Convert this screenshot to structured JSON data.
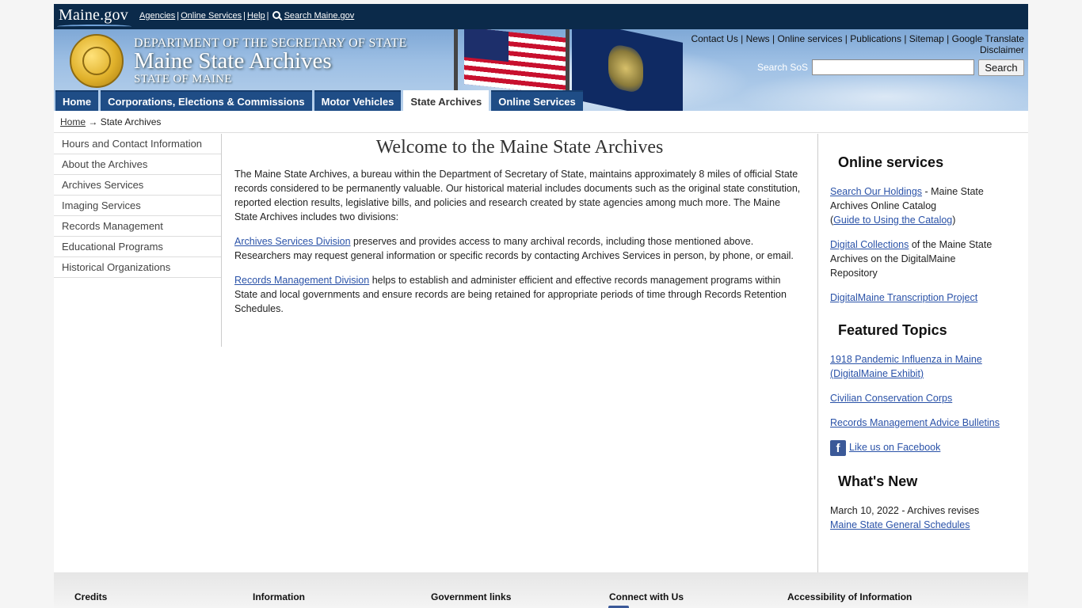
{
  "topbar": {
    "logo": "Maine.gov",
    "links": [
      "Agencies",
      "Online Services",
      "Help"
    ],
    "search_link": "Search Maine.gov"
  },
  "banner": {
    "dept": "DEPARTMENT OF THE SECRETARY OF STATE",
    "title": "Maine State Archives",
    "state": "STATE OF MAINE",
    "util_links": [
      "Contact Us",
      "News",
      "Online services",
      "Publications",
      "Sitemap",
      "Google Translate"
    ],
    "disclaimer": "Disclaimer",
    "search_label": "Search SoS",
    "search_value": "",
    "search_button": "Search"
  },
  "tabs": [
    "Home",
    "Corporations, Elections & Commissions",
    "Motor Vehicles",
    "State Archives",
    "Online Services"
  ],
  "breadcrumb": {
    "home": "Home",
    "arrow": "→",
    "current": "State Archives"
  },
  "leftnav": [
    "Hours and Contact Information",
    "About the Archives",
    "Archives Services",
    "Imaging Services",
    "Records Management",
    "Educational Programs",
    "Historical Organizations"
  ],
  "main": {
    "title": "Welcome to the Maine State Archives",
    "intro": "The Maine State Archives, a bureau within the Department of Secretary of State, maintains approximately 8 miles of official State records considered to be permanently valuable. Our historical material includes documents such as the original state constitution, reported election results, legislative bills, and policies and research created by state agencies among much more. The Maine State Archives includes two divisions:",
    "div1_link": "Archives Services Division",
    "div1_text": " preserves and provides access to many archival records, including those mentioned above. Researchers may request general information or specific records by contacting Archives Services in person, by phone, or email.",
    "div2_link": "Records Management Division",
    "div2_text": " helps to establish and administer efficient and effective records management programs within State and local governments and ensure records are being retained for appropriate periods of time through Records Retention Schedules."
  },
  "right": {
    "online_heading": "Online services",
    "holdings_link": "Search Our Holdings",
    "holdings_text": " - Maine State Archives Online Catalog",
    "guide_link": "Guide to Using the Catalog",
    "digital_link": "Digital Collections",
    "digital_text": " of the Maine State Archives on the DigitalMaine Repository",
    "transcription_link": "DigitalMaine Transcription Project",
    "featured_heading": "Featured Topics",
    "topic1": "1918 Pandemic Influenza in Maine (DigitalMaine Exhibit)",
    "topic2": "Civilian Conservation Corps",
    "topic3": "Records Management Advice Bulletins",
    "facebook": "Like us on Facebook",
    "whatsnew_heading": "What's New",
    "news_text": "March 10, 2022 - Archives revises",
    "news_link": "Maine State General Schedules"
  },
  "footer": [
    "Credits",
    "Information",
    "Government links",
    "Connect with Us",
    "Accessibility of Information"
  ]
}
